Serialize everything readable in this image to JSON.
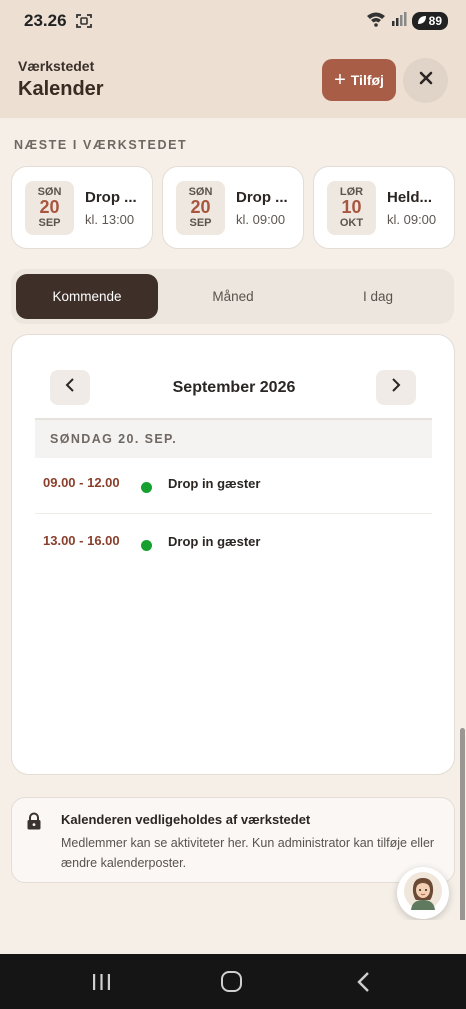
{
  "status_bar": {
    "time": "23.26",
    "battery": "89"
  },
  "header": {
    "subtitle": "Værkstedet",
    "title": "Kalender",
    "add_label": "Tilføj"
  },
  "upcoming": {
    "section_label": "NÆSTE I VÆRKSTEDET",
    "items": [
      {
        "dow": "SØN",
        "day": "20",
        "month": "SEP",
        "title": "Drop ...",
        "time": "kl. 13:00"
      },
      {
        "dow": "SØN",
        "day": "20",
        "month": "SEP",
        "title": "Drop ...",
        "time": "kl. 09:00"
      },
      {
        "dow": "LØR",
        "day": "10",
        "month": "OKT",
        "title": "Held...",
        "time": "kl. 09:00"
      }
    ]
  },
  "tabs": {
    "items": [
      "Kommende",
      "Måned",
      "I dag"
    ],
    "active": "Kommende"
  },
  "calendar": {
    "month_title": "September 2026",
    "day_header": "SØNDAG 20. SEP.",
    "events": [
      {
        "time": "09.00 - 12.00",
        "title": "Drop in gæster",
        "status_color": "#16a02f"
      },
      {
        "time": "13.00 - 16.00",
        "title": "Drop in gæster",
        "status_color": "#16a02f"
      }
    ]
  },
  "info": {
    "title": "Kalenderen vedligeholdes af værkstedet",
    "text": "Medlemmer kan se aktiviteter her. Kun administrator kan tilføje eller ændre kalenderposter."
  },
  "colors": {
    "accent": "#a85d47",
    "active_tab": "#3e2f29",
    "header_bg": "#ede0d3",
    "event_time": "#8a3f2c"
  }
}
